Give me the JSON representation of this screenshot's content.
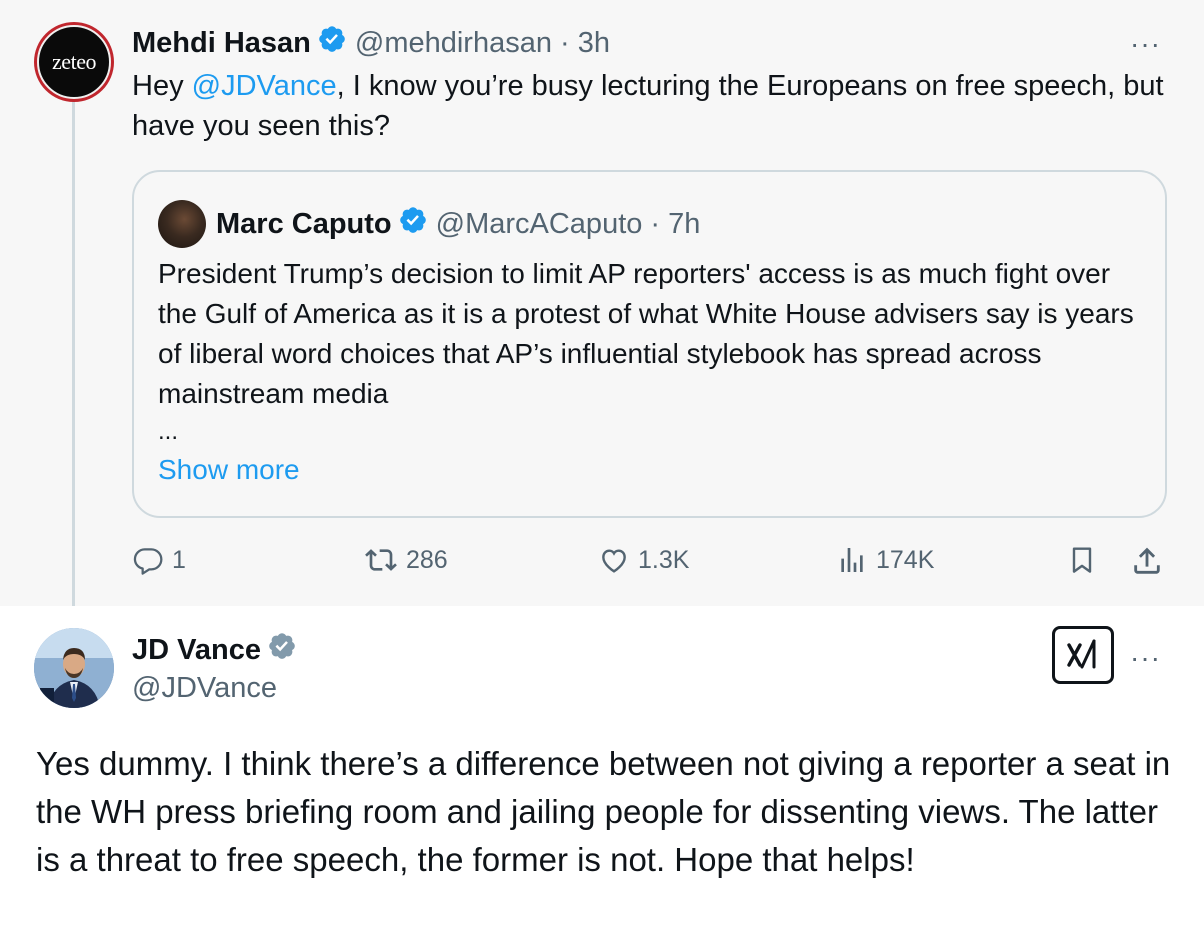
{
  "parent": {
    "avatar_text": "zeteo",
    "name": "Mehdi Hasan",
    "handle_time": "@mehdirhasan · 3h",
    "text_before": "Hey ",
    "mention": "@JDVance",
    "text_after": ", I know you’re busy lecturing the Europeans on free speech, but have you seen this?",
    "more": "···"
  },
  "quote": {
    "name": "Marc Caputo",
    "handle_time": "@MarcACaputo · 7h",
    "text": "President Trump’s decision to limit AP reporters' access is as much fight over the Gulf of America as it is a protest of what White House advisers say is years of liberal word choices that AP’s influential stylebook has spread across mainstream media",
    "ellipsis": "...",
    "show_more": "Show more"
  },
  "actions": {
    "replies": "1",
    "reposts": "286",
    "likes": "1.3K",
    "views": "174K"
  },
  "reply": {
    "name": "JD Vance",
    "handle": "@JDVance",
    "more": "···",
    "text": "Yes dummy. I think there’s a difference between not giving a reporter a seat in the WH press briefing room and jailing people for dissenting views. The latter is a threat to free speech, the former is not. Hope that helps!"
  },
  "colors": {
    "accent": "#1d9bf0",
    "verified_blue": "#1d9bf0",
    "verified_gray": "#829aab",
    "muted": "#536471"
  },
  "icons": [
    "reply-icon",
    "repost-icon",
    "like-icon",
    "views-icon",
    "bookmark-icon",
    "share-icon",
    "grok-icon",
    "verified-badge-icon"
  ]
}
